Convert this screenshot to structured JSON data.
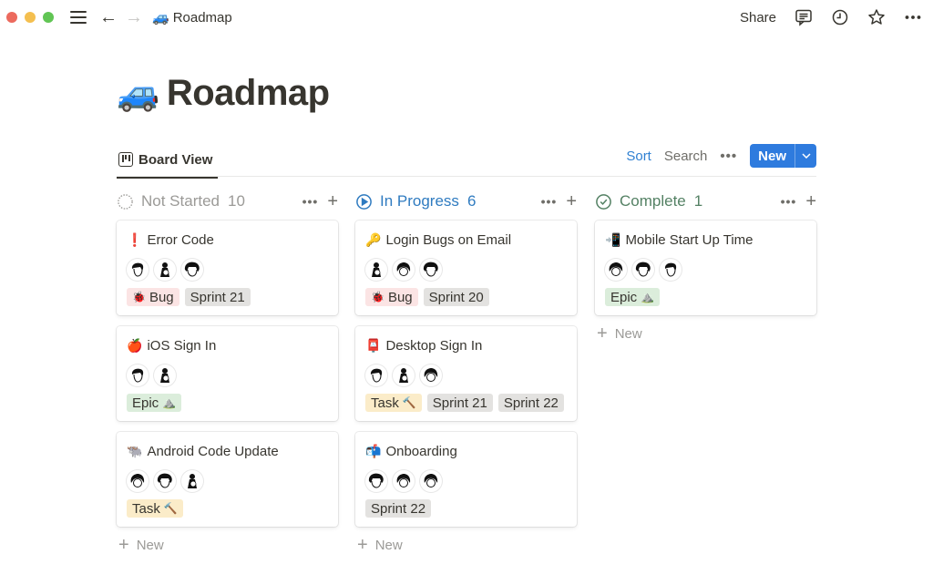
{
  "window": {
    "breadcrumb": {
      "emoji": "🚙",
      "label": "Roadmap"
    },
    "share_label": "Share",
    "icons": [
      "hamburger-icon",
      "back-arrow-icon",
      "forward-arrow-icon",
      "comment-icon",
      "clock-icon",
      "star-icon",
      "more-icon"
    ]
  },
  "page": {
    "emoji": "🚙",
    "title": "Roadmap"
  },
  "view": {
    "tab_label": "Board View",
    "sort_label": "Sort",
    "search_label": "Search",
    "more_label": "•••",
    "new_label": "New",
    "new_dropdown": "⌄"
  },
  "colors": {
    "accent": "#2e7bde",
    "sort": "#2f80d2",
    "not_started": "#9b9a97",
    "in_progress": "#2f7bc0",
    "complete": "#548164"
  },
  "columns": [
    {
      "name": "Not Started",
      "count": "10",
      "status_icon": "dotted-circle-icon",
      "more_label": "•••",
      "add_label": "+",
      "new_label": "New",
      "cards": [
        {
          "emoji": "❗",
          "title": "Error Code",
          "avatars": 3,
          "tags": [
            {
              "type": "bug",
              "emoji": "🐞",
              "label": "Bug"
            },
            {
              "type": "sprint",
              "emoji": "",
              "label": "Sprint 21"
            }
          ]
        },
        {
          "emoji": "🍎",
          "title": "iOS Sign In",
          "avatars": 2,
          "tags": [
            {
              "type": "epic",
              "emoji": "⛰️",
              "label": "Epic"
            }
          ]
        },
        {
          "emoji": "🐃",
          "title": "Android Code Update",
          "avatars": 3,
          "tags": [
            {
              "type": "task",
              "emoji": "🔨",
              "label": "Task"
            }
          ]
        }
      ]
    },
    {
      "name": "In Progress",
      "count": "6",
      "status_icon": "play-circle-icon",
      "more_label": "•••",
      "add_label": "+",
      "new_label": "New",
      "cards": [
        {
          "emoji": "🔑",
          "title": "Login Bugs on Email",
          "avatars": 3,
          "tags": [
            {
              "type": "bug",
              "emoji": "🐞",
              "label": "Bug"
            },
            {
              "type": "sprint",
              "emoji": "",
              "label": "Sprint 20"
            }
          ]
        },
        {
          "emoji": "📮",
          "title": "Desktop Sign In",
          "avatars": 3,
          "tags": [
            {
              "type": "task",
              "emoji": "🔨",
              "label": "Task"
            },
            {
              "type": "sprint",
              "emoji": "",
              "label": "Sprint 21"
            },
            {
              "type": "sprint",
              "emoji": "",
              "label": "Sprint 22"
            }
          ]
        },
        {
          "emoji": "📬",
          "title": "Onboarding",
          "avatars": 3,
          "tags": [
            {
              "type": "sprint",
              "emoji": "",
              "label": "Sprint 22"
            }
          ]
        }
      ]
    },
    {
      "name": "Complete",
      "count": "1",
      "status_icon": "check-circle-icon",
      "more_label": "•••",
      "add_label": "+",
      "new_label": "New",
      "cards": [
        {
          "emoji": "📲",
          "title": "Mobile Start Up Time",
          "avatars": 3,
          "tags": [
            {
              "type": "epic",
              "emoji": "⛰️",
              "label": "Epic"
            }
          ]
        }
      ]
    }
  ]
}
